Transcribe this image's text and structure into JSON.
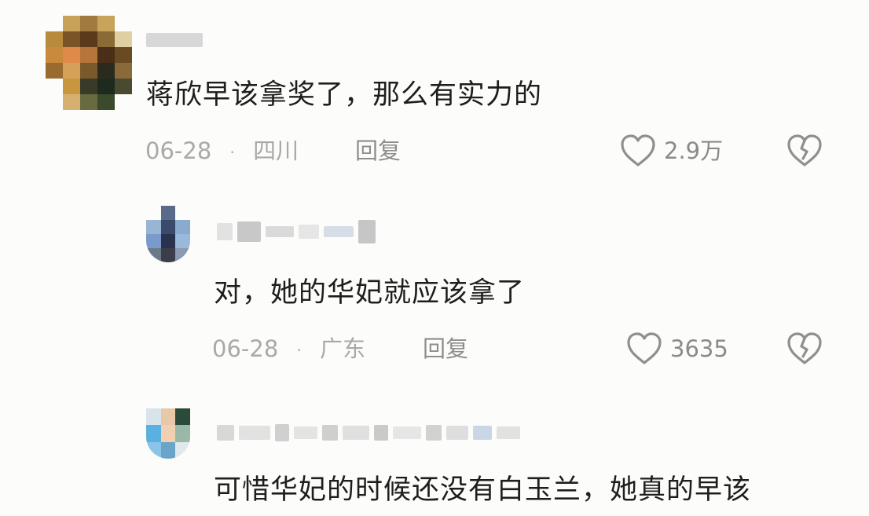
{
  "comments": [
    {
      "text": "蒋欣早该拿奖了，那么有实力的",
      "date": "06-28",
      "separator": "·",
      "location": "四川",
      "reply_label": "回复",
      "likes": "2.9万"
    },
    {
      "text": "对，她的华妃就应该拿了",
      "date": "06-28",
      "separator": "·",
      "location": "广东",
      "reply_label": "回复",
      "likes": "3635"
    },
    {
      "text": "可惜华妃的时候还没有白玉兰，她真的早该"
    }
  ],
  "icons": {
    "like": "heart-outline-icon",
    "dislike": "broken-heart-icon"
  },
  "colors": {
    "background": "#fcfcfa",
    "text": "#1e1e1e",
    "meta": "#a9a9a9",
    "icon": "#8f8f8f"
  }
}
